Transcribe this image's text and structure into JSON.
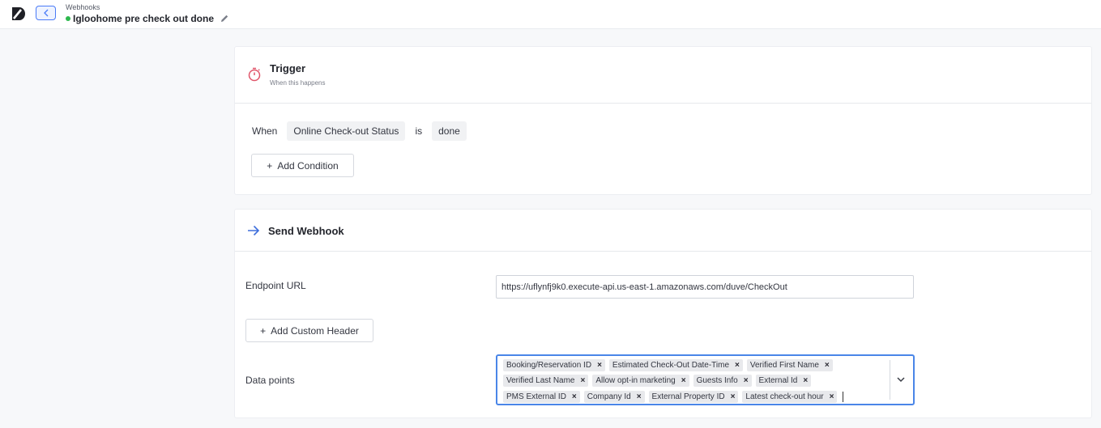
{
  "header": {
    "breadcrumb": "Webhooks",
    "title": "Igloohome pre check out done",
    "status_color": "#2db84d"
  },
  "trigger": {
    "title": "Trigger",
    "subtitle": "When this happens",
    "condition": {
      "when": "When",
      "field": "Online Check-out Status",
      "operator": "is",
      "value": "done"
    },
    "add_condition": "Add Condition"
  },
  "webhook": {
    "title": "Send Webhook",
    "endpoint_label": "Endpoint URL",
    "endpoint_value": "https://uflynfj9k0.execute-api.us-east-1.amazonaws.com/duve/CheckOut",
    "add_header": "Add Custom Header",
    "data_points_label": "Data points",
    "data_points": [
      [
        "Booking/Reservation ID",
        "Estimated Check-Out Date-Time",
        "Verified First Name"
      ],
      [
        "Verified Last Name",
        "Allow opt-in marketing",
        "Guests Info",
        "External Id"
      ],
      [
        "PMS External ID",
        "Company Id",
        "External Property ID",
        "Latest check-out hour"
      ]
    ]
  },
  "colors": {
    "accent": "#4a86e8",
    "trigger_icon": "#e0566b"
  }
}
